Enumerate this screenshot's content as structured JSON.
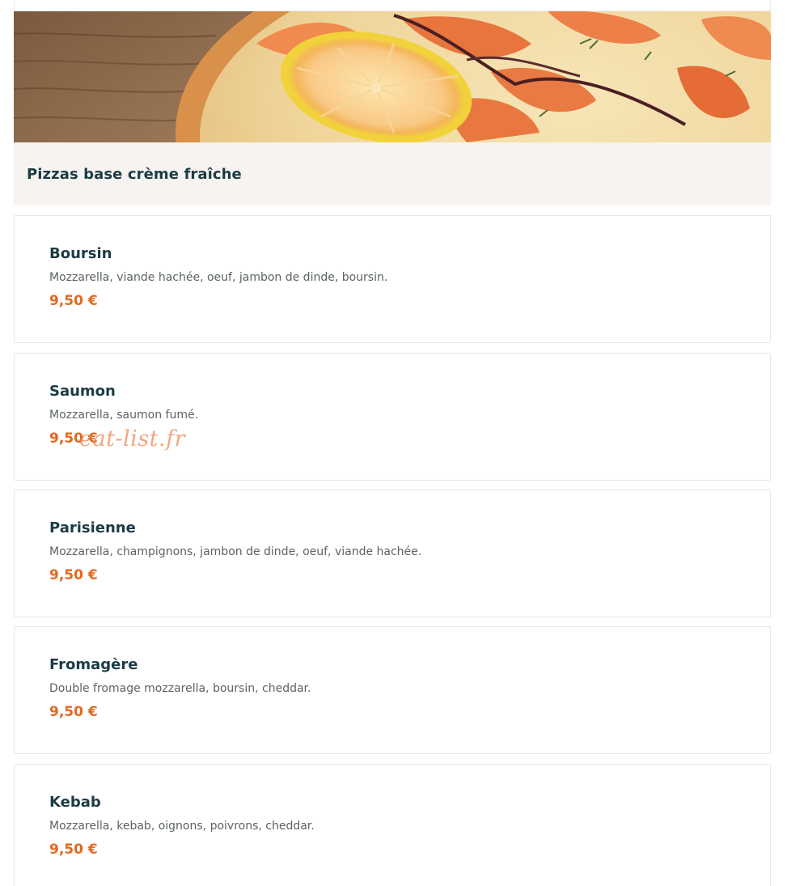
{
  "category": {
    "title": "Pizzas base crème fraîche"
  },
  "items": [
    {
      "name": "Boursin",
      "description": "Mozzarella, viande hachée, oeuf, jambon de dinde, boursin.",
      "price": "9,50 €"
    },
    {
      "name": "Saumon",
      "description": "Mozzarella, saumon fumé.",
      "price": "9,50 €"
    },
    {
      "name": "Parisienne",
      "description": "Mozzarella, champignons, jambon de dinde, oeuf, viande hachée.",
      "price": "9,50 €"
    },
    {
      "name": "Fromagère",
      "description": "Double fromage mozzarella, boursin, cheddar.",
      "price": "9,50 €"
    },
    {
      "name": "Kebab",
      "description": "Mozzarella, kebab, oignons, poivrons, cheddar.",
      "price": "9,50 €"
    }
  ],
  "watermark": "eat-list.fr",
  "colors": {
    "title": "#1c3b45",
    "price": "#e2681f",
    "header_bg": "#f6f3f0"
  }
}
